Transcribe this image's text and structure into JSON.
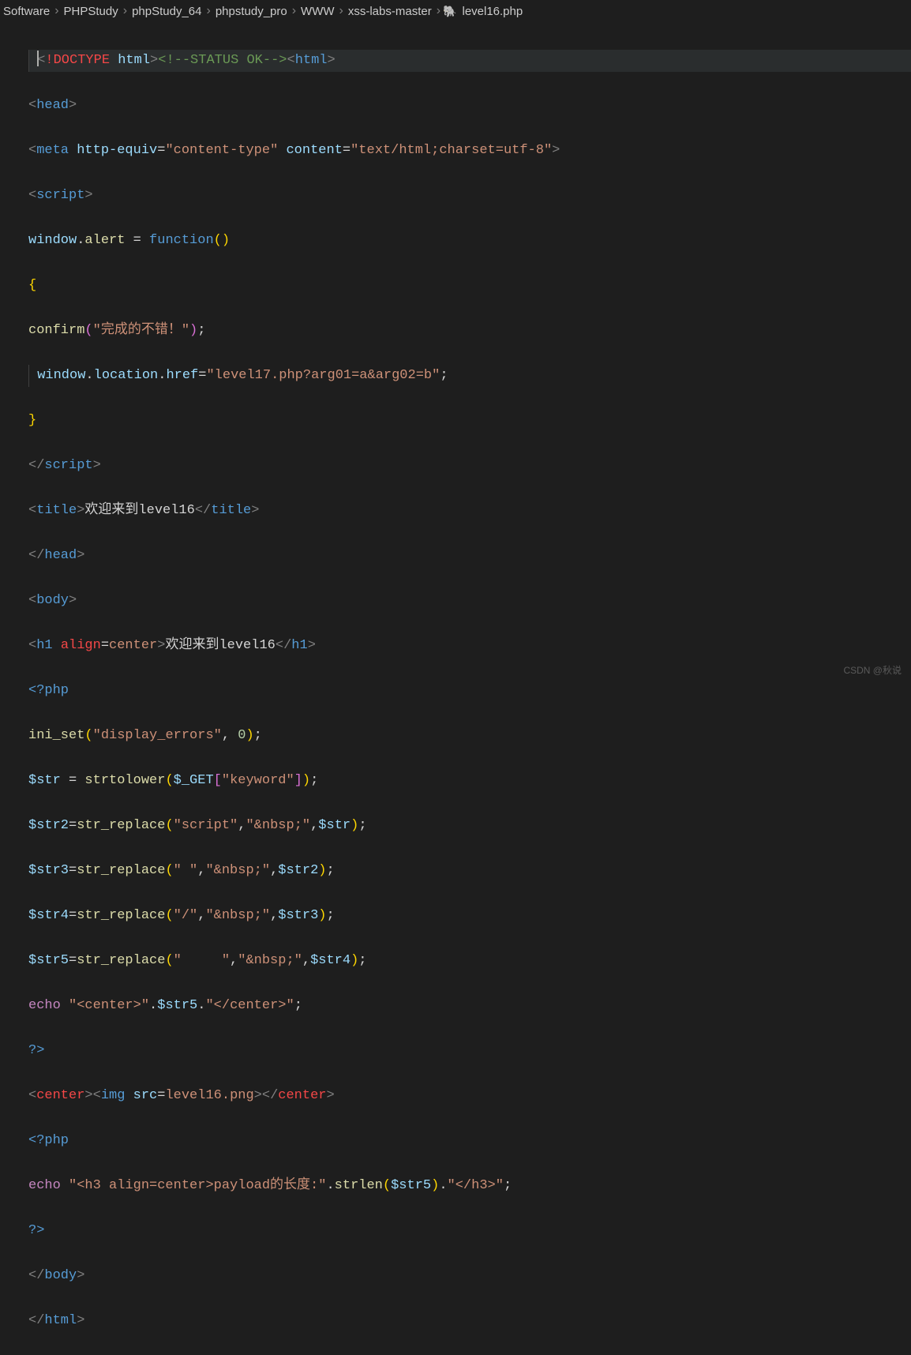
{
  "breadcrumb": {
    "items": [
      "Software",
      "PHPStudy",
      "phpStudy_64",
      "phpstudy_pro",
      "WWW",
      "xss-labs-master",
      "level16.php"
    ]
  },
  "code": {
    "doctype": "!DOCTYPE",
    "html": "html",
    "comment_status": "<!--STATUS OK-->",
    "head": "head",
    "meta": "meta",
    "http_equiv_attr": "http-equiv",
    "http_equiv_val": "\"content-type\"",
    "content_attr": "content",
    "content_val": "\"text/html;charset=utf-8\"",
    "script_tag": "script",
    "window": "window",
    "alert": "alert",
    "function": "function",
    "confirm": "confirm",
    "confirm_str": "\"完成的不错！\"",
    "location": "location",
    "href": "href",
    "href_str": "\"level17.php?arg01=a&arg02=b\"",
    "title_tag": "title",
    "title_text_cn": "欢迎来到",
    "title_text_en": "level16",
    "body_tag": "body",
    "h1_tag": "h1",
    "align_attr": "align",
    "center_val": "center",
    "php_open": "<?php",
    "ini_set": "ini_set",
    "display_errors": "\"display_errors\"",
    "zero": "0",
    "str_var": "$str",
    "strtolower": "strtolower",
    "get": "$_GET",
    "keyword": "\"keyword\"",
    "str2": "$str2",
    "str3": "$str3",
    "str4": "$str4",
    "str5": "$str5",
    "str_replace": "str_replace",
    "script_str": "\"script\"",
    "nbsp_str": "\"&nbsp;\"",
    "space_str": "\" \"",
    "tab_str": "\"\t\"",
    "slash_str": "\"/\"",
    "echo": "echo",
    "center_open": "\"<center>\"",
    "center_close": "\"</center>\"",
    "php_close": "?>",
    "center_tag": "center",
    "img_tag": "img",
    "src_attr": "src",
    "level16png": "level16.png",
    "h3_echo": "\"<h3 align=center>payload的长度:\"",
    "strlen": "strlen",
    "h3_close": "\"</h3>\""
  },
  "watermark": "CSDN @秋说"
}
